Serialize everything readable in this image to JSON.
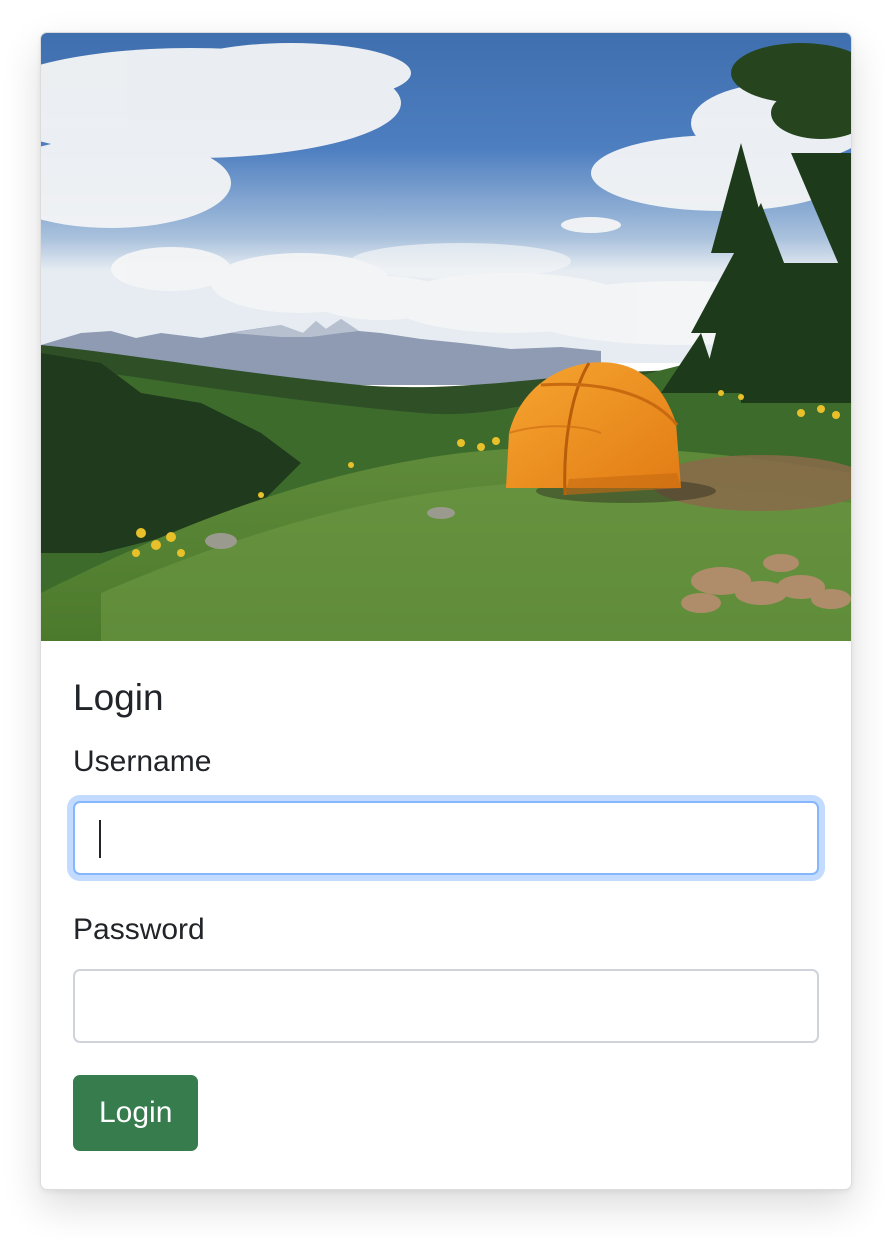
{
  "card": {
    "title": "Login",
    "hero_image": "campsite-tent-mountains"
  },
  "form": {
    "username_label": "Username",
    "username_value": "",
    "password_label": "Password",
    "password_value": "",
    "submit_label": "Login"
  },
  "colors": {
    "primary_button": "#377c4d",
    "focus_ring": "#86b7fe",
    "text": "#212529",
    "input_border": "#ced4da"
  }
}
